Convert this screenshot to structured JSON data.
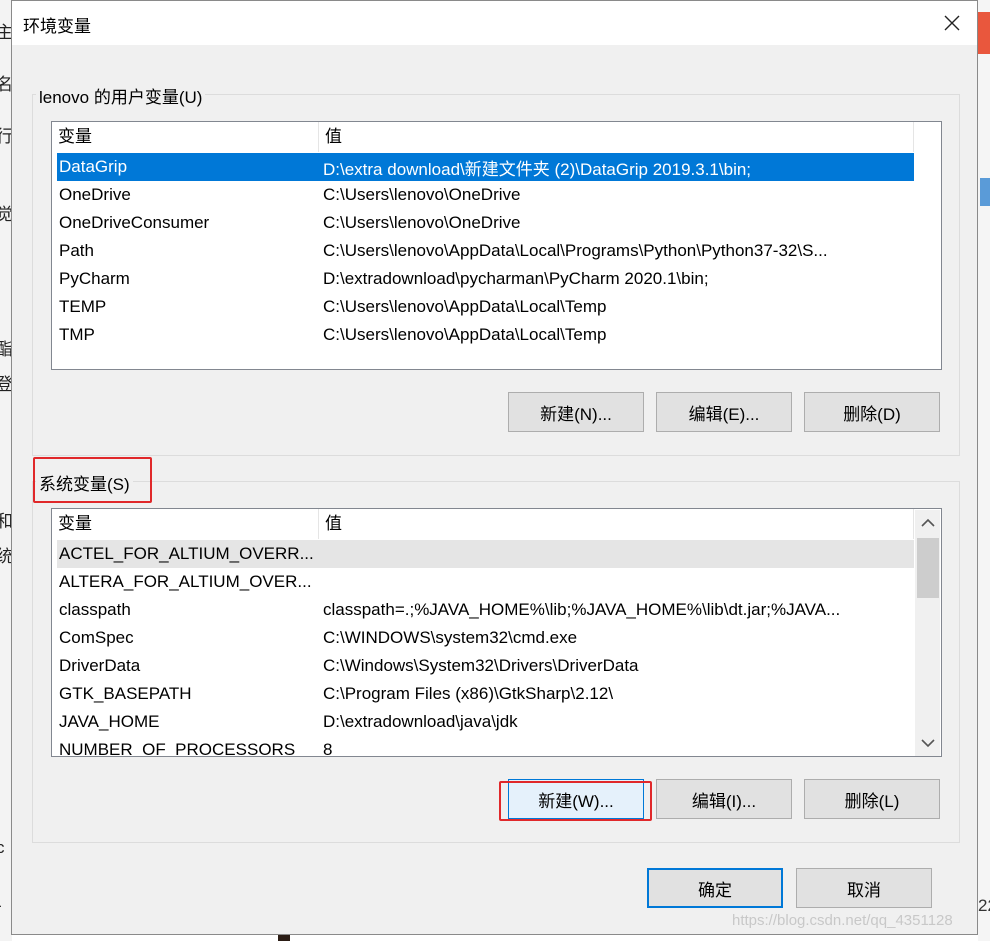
{
  "dialog": {
    "title": "环境变量"
  },
  "user_vars": {
    "group_label": "lenovo 的用户变量(U)",
    "columns": [
      "变量",
      "值"
    ],
    "rows": [
      {
        "name": "DataGrip",
        "value": "D:\\extra download\\新建文件夹 (2)\\DataGrip 2019.3.1\\bin;",
        "selected": true
      },
      {
        "name": "OneDrive",
        "value": "C:\\Users\\lenovo\\OneDrive"
      },
      {
        "name": "OneDriveConsumer",
        "value": "C:\\Users\\lenovo\\OneDrive"
      },
      {
        "name": "Path",
        "value": "C:\\Users\\lenovo\\AppData\\Local\\Programs\\Python\\Python37-32\\S..."
      },
      {
        "name": "PyCharm",
        "value": "D:\\extradownload\\pycharman\\PyCharm 2020.1\\bin;"
      },
      {
        "name": "TEMP",
        "value": "C:\\Users\\lenovo\\AppData\\Local\\Temp"
      },
      {
        "name": "TMP",
        "value": "C:\\Users\\lenovo\\AppData\\Local\\Temp"
      }
    ],
    "buttons": {
      "new": "新建(N)...",
      "edit": "编辑(E)...",
      "delete": "删除(D)"
    }
  },
  "sys_vars": {
    "group_label": "系统变量(S)",
    "columns": [
      "变量",
      "值"
    ],
    "rows": [
      {
        "name": "ACTEL_FOR_ALTIUM_OVERR...",
        "value": "",
        "hover": true
      },
      {
        "name": "ALTERA_FOR_ALTIUM_OVER...",
        "value": ""
      },
      {
        "name": "classpath",
        "value": "classpath=.;%JAVA_HOME%\\lib;%JAVA_HOME%\\lib\\dt.jar;%JAVA..."
      },
      {
        "name": "ComSpec",
        "value": "C:\\WINDOWS\\system32\\cmd.exe"
      },
      {
        "name": "DriverData",
        "value": "C:\\Windows\\System32\\Drivers\\DriverData"
      },
      {
        "name": "GTK_BASEPATH",
        "value": "C:\\Program Files (x86)\\GtkSharp\\2.12\\"
      },
      {
        "name": "JAVA_HOME",
        "value": "D:\\extradownload\\java\\jdk"
      },
      {
        "name": "NUMBER_OF_PROCESSORS",
        "value": "8"
      }
    ],
    "buttons": {
      "new": "新建(W)...",
      "edit": "编辑(I)...",
      "delete": "删除(L)"
    }
  },
  "footer": {
    "ok": "确定",
    "cancel": "取消"
  },
  "background": {
    "left_glyphs": [
      "主",
      "名",
      "行",
      "觉",
      "酯",
      "登",
      "和",
      "统",
      "c",
      "-"
    ],
    "right_text": "22"
  },
  "watermark": "https://blog.csdn.net/qq_4351128",
  "colors": {
    "selection": "#0078d7",
    "highlight": "#e0282a"
  }
}
